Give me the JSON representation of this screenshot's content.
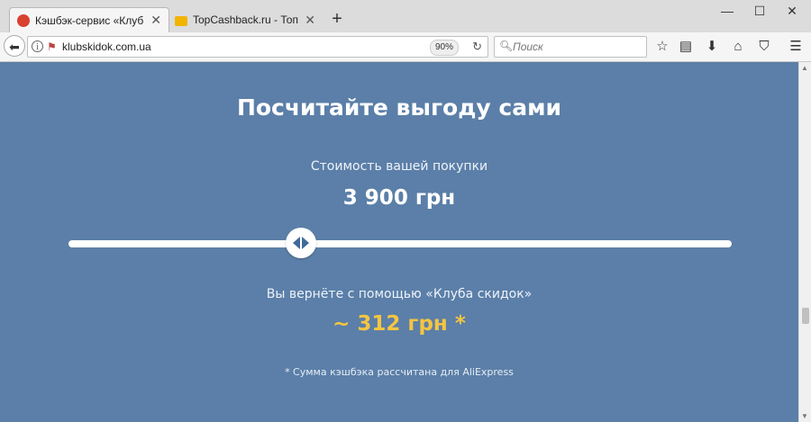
{
  "browser": {
    "tabs": [
      {
        "title": "Кэшбэк-сервис «Клуб скид",
        "active": true
      },
      {
        "title": "TopCashback.ru - Топ лучш",
        "active": false
      }
    ],
    "new_tab_label": "+",
    "window_buttons": {
      "minimize": "—",
      "maximize": "☐",
      "close": "✕"
    },
    "url": "klubskidok.com.ua",
    "zoom": "90%",
    "search_placeholder": "Поиск",
    "icons": [
      "back-icon",
      "info-icon",
      "tracking-shield-icon",
      "reload-icon",
      "search-icon",
      "bookmark-star-icon",
      "reading-list-icon",
      "download-icon",
      "home-icon",
      "pocket-icon",
      "menu-icon"
    ]
  },
  "page": {
    "heading": "Посчитайте выгоду сами",
    "price_label": "Стоимость вашей покупки",
    "price_value": "3 900 грн",
    "slider_level": 0.35,
    "return_label": "Вы вернёте с помощью «Клуба скидок»",
    "return_value": "~ 312 грн *",
    "footnote": "* Сумма кэшбэка рассчитана для AliExpress"
  },
  "colors": {
    "background": "#5b7fa8",
    "accent_yellow": "#f4c542",
    "handle_arrows": "#3f6a99"
  }
}
